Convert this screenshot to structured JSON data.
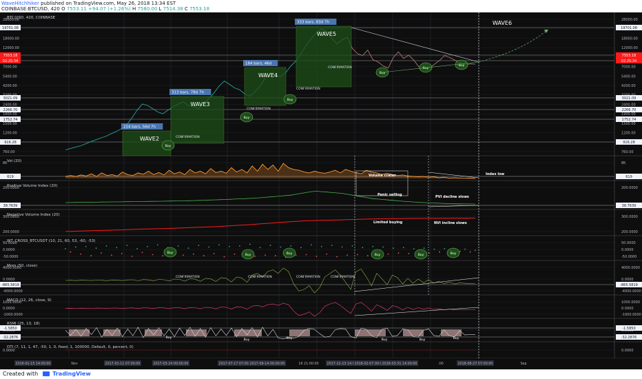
{
  "header": {
    "author": "WaveHitchhiker",
    "publish_text": "published on TradingView.com, May 26, 2018 13:34 EST",
    "symbol_line": "COINBASE:BTCUSD, 420",
    "ohlc": [
      {
        "k": "O",
        "v": "7553.11"
      },
      {
        "k": "H",
        "v": "+94.07 (+1.26%)"
      },
      {
        "k": "H",
        "v": "7580.00"
      },
      {
        "k": "L",
        "v": "7514.38"
      },
      {
        "k": "C",
        "v": "7553.18"
      }
    ]
  },
  "footer": {
    "created": "Created with",
    "brand": "TradingView"
  },
  "chart_data": [
    {
      "type": "line",
      "panel": "main",
      "title": "BTC/USD, 420, COINBASE",
      "y_scale": "log",
      "y_ticks": [
        "28000.00",
        "22000.00",
        "18000.00",
        "12000.00",
        "9000.00",
        "7000.00",
        "5400.00",
        "4200.00",
        "3200.00",
        "2400.00",
        "1900.00",
        "1500.00",
        "1200.00",
        "950.00",
        "760.00"
      ],
      "y_markers": [
        {
          "label": "19701.08",
          "color": "#f0f3fa"
        },
        {
          "label": "7553.18",
          "color": "#ff1a1a"
        },
        {
          "label": "02:25:34",
          "color": "#ff1a1a"
        },
        {
          "label": "3021.09",
          "color": "#f0f3fa"
        },
        {
          "label": "2266.70",
          "color": "#f0f3fa"
        },
        {
          "label": "1752.74",
          "color": "#f0f3fa"
        },
        {
          "label": "916.28",
          "color": "#f0f3fa"
        }
      ],
      "series": [
        {
          "values": [
            760,
            790,
            820,
            850,
            900,
            950,
            1000,
            1050,
            1100,
            1180,
            1250,
            1350,
            1500,
            1800,
            2200,
            2600,
            2500,
            2300,
            2100,
            2000,
            2200,
            2400,
            2600,
            2750,
            2500,
            2400,
            2300,
            2600,
            3000,
            3500,
            4200,
            4800,
            4400,
            4000,
            3800,
            3400,
            3200,
            3600,
            4200,
            5200,
            6000,
            5600,
            5400,
            6000,
            7200,
            8200,
            10000,
            12500,
            15000,
            17500,
            19500,
            18000,
            15000,
            13000,
            14500,
            15500,
            11500,
            10000,
            9500,
            11000,
            8500,
            8000,
            7200,
            6800,
            9000,
            10500,
            8800,
            9600,
            8400,
            7000,
            7200,
            6800,
            7500,
            8300,
            9500,
            9000,
            8400,
            7800,
            7400,
            7600,
            7553
          ]
        }
      ],
      "annotations": {
        "waves": [
          "WAVE2",
          "WAVE3",
          "WAVE4",
          "WAVE5",
          "WAVE6"
        ],
        "bars_labels": [
          "224 bars, 56d 7h",
          "313 bars, 78d 7h",
          "184 bars, 46d",
          "333 bars, 83d 7h"
        ],
        "confirmation": "CONFIRMATION",
        "buy": "Buy"
      }
    },
    {
      "type": "area",
      "panel": "vol",
      "title": "Vol (20)",
      "y_ticks": [
        "8K",
        "4K"
      ],
      "y_markers": [
        {
          "label": "619",
          "color": "#f0f3fa"
        }
      ],
      "annotations": {
        "volume_crater": "Volume crater",
        "index_low": "Index low"
      },
      "series": [
        {
          "values": [
            2,
            2.5,
            2,
            2.8,
            2.2,
            3.5,
            2,
            4,
            2.5,
            3,
            2.2,
            4.5,
            3,
            2.5,
            4,
            3.2,
            5,
            3,
            4.2,
            2.8,
            5.5,
            3.5,
            4.5,
            3,
            6,
            4,
            5,
            3.5,
            6.5,
            4.2,
            5,
            3.8,
            7,
            4.5,
            6,
            4,
            8,
            5,
            9,
            6,
            8.5,
            5,
            9.5,
            7,
            6,
            5.5,
            4.5,
            4,
            5,
            4.2,
            3.8,
            4.5,
            5.5,
            4,
            6,
            5,
            4.2,
            3.5,
            5.5,
            4.5,
            4,
            3.2,
            3.8,
            3,
            2.5,
            2.8,
            2.2,
            2,
            1.8,
            2,
            1.5,
            1.8,
            1.2,
            1.5,
            1,
            1.2,
            1,
            0.9,
            1,
            0.8
          ]
        }
      ]
    },
    {
      "type": "line",
      "panel": "pvi",
      "title": "Positive Volume Index (20)",
      "y_ticks": [
        "200.0000",
        "100.0000"
      ],
      "y_markers": [
        {
          "label": "38.7639",
          "color": "#f0f3fa"
        }
      ],
      "annotations": {
        "panic_selling": "Panic selling",
        "pvi_decline": "PVI decline slows"
      },
      "series": [
        {
          "values": [
            55,
            56,
            57,
            58,
            58,
            59,
            60,
            61,
            62,
            63,
            63,
            64,
            65,
            66,
            66,
            67,
            68,
            69,
            70,
            71,
            72,
            73,
            74,
            75,
            76,
            78,
            80,
            82,
            84,
            86,
            88,
            90,
            92,
            95,
            98,
            100,
            103,
            106,
            110,
            115,
            120,
            125,
            130,
            135,
            140,
            150,
            160,
            170,
            180,
            185,
            180,
            175,
            170,
            165,
            160,
            150,
            140,
            130,
            120,
            110,
            100,
            95,
            90,
            85,
            80,
            75,
            70,
            66,
            62,
            58,
            55,
            52,
            50,
            48,
            45,
            43,
            42,
            41,
            40,
            39,
            38.8
          ]
        }
      ]
    },
    {
      "type": "line",
      "panel": "nvi",
      "title": "Negative Volume Index (20)",
      "y_ticks": [
        "300.0000",
        "200.0000"
      ],
      "annotations": {
        "limited_buying": "Limited buying",
        "nvi_incline": "NVI incline slows"
      },
      "series": [
        {
          "values": [
            180,
            182,
            184,
            186,
            188,
            190,
            192,
            194,
            196,
            198,
            200,
            202,
            205,
            208,
            210,
            212,
            214,
            216,
            218,
            220,
            222,
            225,
            228,
            230,
            232,
            235,
            238,
            240,
            243,
            246,
            250,
            254,
            258,
            262,
            266,
            270,
            275,
            280,
            285,
            290,
            295,
            300,
            305,
            310,
            315,
            320,
            325,
            328,
            330,
            332,
            335,
            336,
            338,
            340,
            342,
            344,
            346,
            348,
            350,
            352,
            354,
            355,
            356,
            357,
            358,
            359,
            360,
            361,
            362,
            362,
            363,
            363,
            364,
            364,
            365,
            365,
            365,
            366,
            366,
            366,
            366
          ]
        }
      ]
    },
    {
      "type": "scatter",
      "panel": "wt",
      "title": "WT_CROSS_BTCUSDT (10, 21, 60, 53, -60, -53)",
      "y_ticks": [
        "50.0000",
        "0.0000",
        "-50.0000"
      ],
      "annotations": {
        "buy": "Buy"
      },
      "series": [
        {
          "values": [
            20,
            -10,
            35,
            -30,
            40,
            -45,
            25,
            -20,
            45,
            -40,
            30,
            -25,
            50,
            -50,
            20,
            -15,
            40,
            -35,
            55,
            -45,
            30,
            -20,
            45,
            -40,
            25,
            -30,
            50,
            -45,
            35,
            -25,
            55,
            -55,
            40,
            -30,
            45,
            -35,
            60,
            -50,
            30,
            -40,
            50,
            -45,
            35,
            -60,
            45,
            -40,
            30,
            -35,
            55,
            -50,
            40,
            -30,
            50,
            -55,
            35,
            -40,
            45,
            -35,
            30,
            -45,
            40,
            -25,
            35,
            -30,
            25,
            -20,
            30,
            -25,
            20,
            -15,
            25,
            -20,
            15,
            -10,
            20,
            -15,
            10,
            -5,
            15,
            -10,
            5
          ]
        }
      ]
    },
    {
      "type": "line",
      "panel": "mom",
      "title": "Mom (50, close)",
      "y_ticks": [
        "4000.0000",
        "0.0000",
        "-4000.0000"
      ],
      "y_markers": [
        {
          "label": "-865.5819",
          "color": "#f0f3fa"
        }
      ],
      "annotations": {
        "confirmation": "CONFIRMATION"
      },
      "series": [
        {
          "values": [
            0,
            50,
            -30,
            80,
            40,
            -20,
            100,
            60,
            -50,
            120,
            80,
            -40,
            150,
            200,
            -100,
            250,
            150,
            -80,
            300,
            200,
            -150,
            400,
            300,
            -200,
            500,
            350,
            -250,
            600,
            450,
            -300,
            800,
            600,
            -400,
            1000,
            700,
            -500,
            1500,
            2000,
            1000,
            2500,
            3000,
            2000,
            3500,
            2500,
            -1000,
            -3000,
            -2500,
            -1500,
            -3500,
            -2000,
            1000,
            2000,
            3000,
            1500,
            -500,
            -2500,
            2500,
            3200,
            1000,
            -1500,
            2000,
            500,
            -1200,
            1500,
            800,
            -1000,
            600,
            -800,
            400,
            -600,
            200,
            -700,
            -300,
            -900,
            -500,
            -1000,
            -700,
            -800,
            -900,
            -866
          ]
        }
      ]
    },
    {
      "type": "line",
      "panel": "macd",
      "title": "MACD (12, 26, close, 9)",
      "y_ticks": [
        "1000.0000",
        "0.0000",
        "-1000.0000"
      ],
      "series": [
        {
          "values": [
            0,
            5,
            -5,
            10,
            5,
            -5,
            15,
            10,
            -10,
            20,
            15,
            -15,
            25,
            30,
            -20,
            35,
            25,
            -15,
            40,
            30,
            -25,
            50,
            40,
            -30,
            60,
            45,
            -35,
            70,
            55,
            -40,
            90,
            70,
            -50,
            110,
            80,
            -60,
            150,
            200,
            100,
            250,
            300,
            200,
            350,
            250,
            -200,
            -500,
            -400,
            -250,
            -550,
            -300,
            150,
            300,
            400,
            200,
            -100,
            -350,
            300,
            400,
            150,
            -200,
            250,
            80,
            -150,
            180,
            100,
            -120,
            70,
            -90,
            50,
            -70,
            30,
            -80,
            -40,
            -100,
            -60,
            -110,
            -80,
            -90,
            -100,
            -95
          ]
        }
      ]
    },
    {
      "type": "line",
      "panel": "rsi",
      "title": "RSMI (25, 13, 18)",
      "y_ticks": [
        "0.0000"
      ],
      "y_markers": [
        {
          "label": "-1.5850",
          "color": "#f0f3fa"
        },
        {
          "label": "-32.2876",
          "color": "#f0f3fa"
        }
      ],
      "annotations": {
        "buy": "Buy"
      },
      "series": [
        {
          "values": [
            20,
            -40,
            30,
            -50,
            40,
            -30,
            50,
            -60,
            30,
            -40,
            45,
            -55,
            35,
            -45,
            55,
            -65,
            40,
            -35,
            50,
            -45,
            35,
            -55,
            45,
            -40,
            55,
            -50,
            40,
            -60,
            50,
            -45,
            35,
            -40,
            45,
            -55,
            40,
            -35,
            50,
            -60,
            55,
            -45,
            30,
            -70,
            -80,
            -60,
            -75,
            -50,
            20,
            40,
            30,
            -20,
            -60,
            -50,
            25,
            40,
            35,
            -55,
            -70,
            45,
            30,
            -45,
            -65,
            30,
            45,
            -50,
            -40,
            35,
            25,
            -55,
            -60,
            20,
            35,
            -40,
            -50,
            25,
            -45,
            -55,
            15,
            -35,
            -30,
            -32
          ]
        }
      ]
    },
    {
      "type": "line",
      "panel": "dti",
      "title": "DTI (7, 11, 1, 47, -50, 1, 0, fixed, 1, 100000, Default, 0, percent, 0)",
      "y_ticks": [
        "0.0000"
      ]
    }
  ],
  "x_axis": {
    "ticks": [
      "2016-01-15 14:00:00",
      "Nov",
      "2017-01-11 07:00:00",
      "2017-03-24 00:00:00",
      "2017-07-17 07:00:00",
      "2017-09-14 00:00:00",
      "16 21:00:00",
      "2017-12-23 14:00:00",
      "2018-02-07 00:00:00",
      "2018-03-31 14:00:00",
      ":00",
      "2018-06-27 07:00:00",
      "Sep"
    ]
  }
}
